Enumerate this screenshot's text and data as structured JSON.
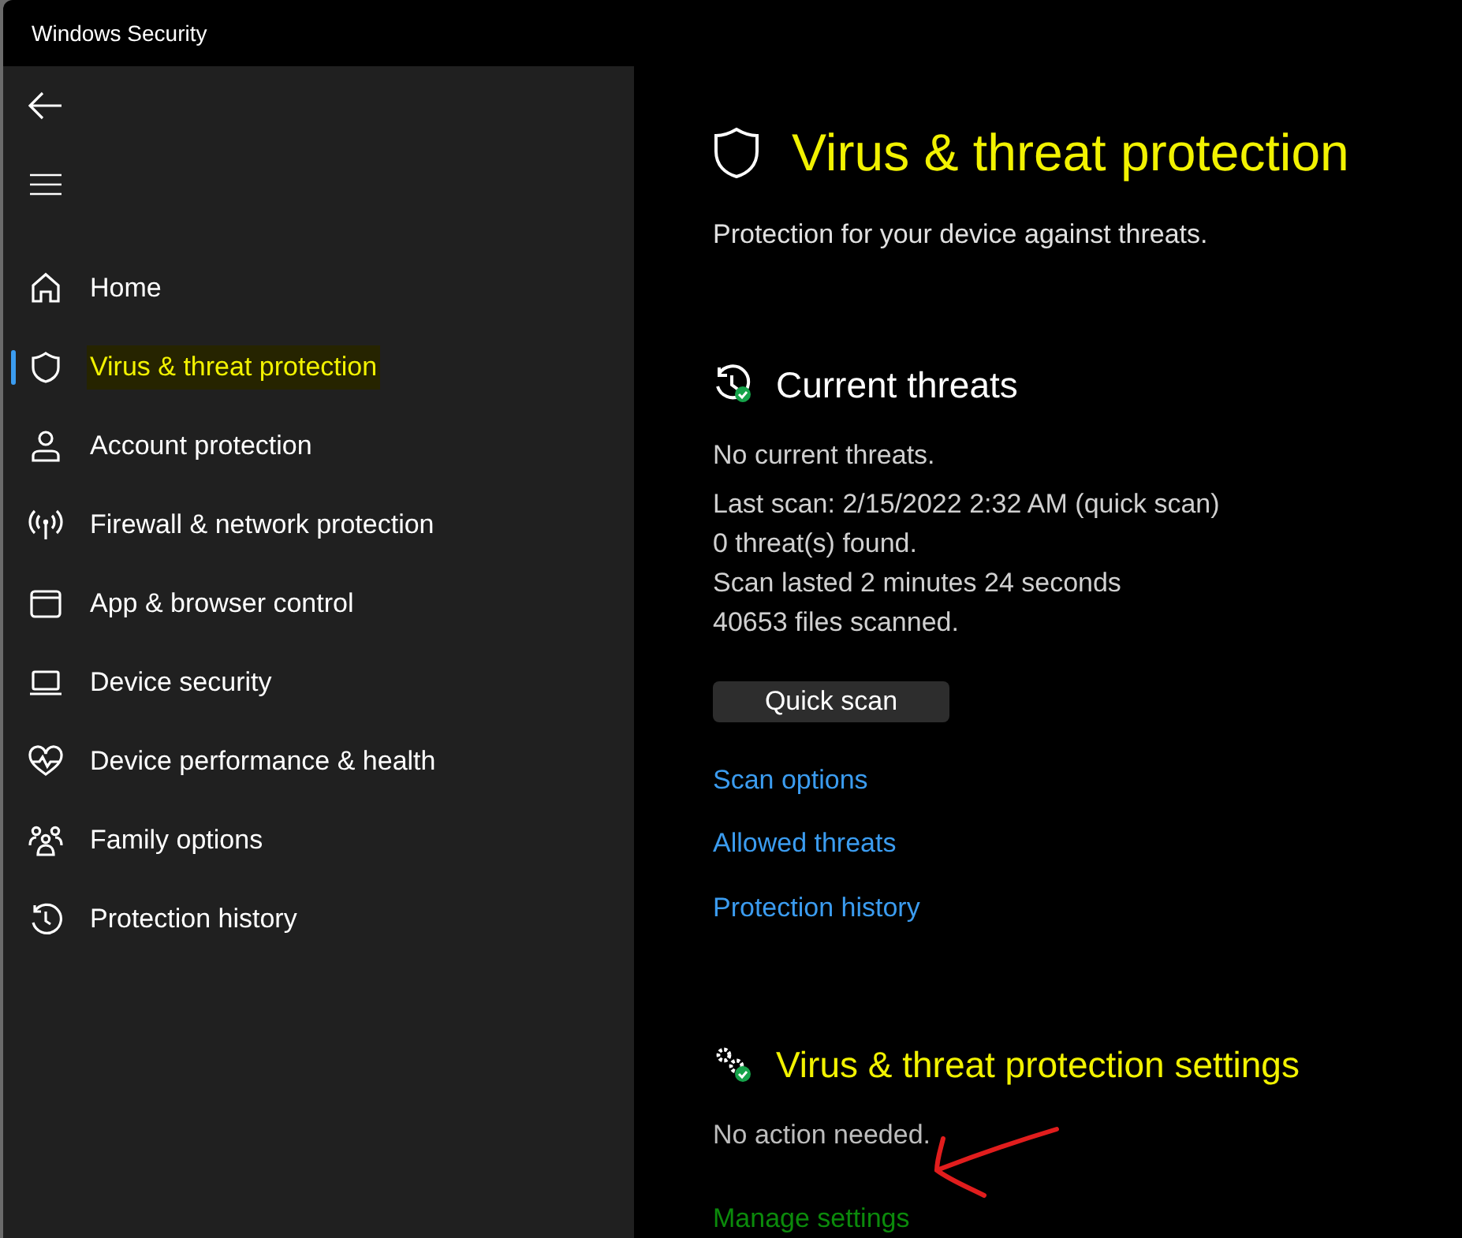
{
  "window": {
    "title": "Windows Security"
  },
  "sidebar": {
    "items": [
      {
        "label": "Home",
        "selected": false
      },
      {
        "label": "Virus & threat protection",
        "selected": true
      },
      {
        "label": "Account protection",
        "selected": false
      },
      {
        "label": "Firewall & network protection",
        "selected": false
      },
      {
        "label": "App & browser control",
        "selected": false
      },
      {
        "label": "Device security",
        "selected": false
      },
      {
        "label": "Device performance & health",
        "selected": false
      },
      {
        "label": "Family options",
        "selected": false
      },
      {
        "label": "Protection history",
        "selected": false
      }
    ]
  },
  "page": {
    "title": "Virus & threat protection",
    "subtitle": "Protection for your device against threats."
  },
  "current_threats": {
    "heading": "Current threats",
    "status": "No current threats.",
    "details": [
      "Last scan: 2/15/2022 2:32 AM (quick scan)",
      "0 threat(s) found.",
      "Scan lasted 2 minutes 24 seconds",
      "40653 files scanned."
    ],
    "button": "Quick scan",
    "links": [
      "Scan options",
      "Allowed threats",
      "Protection history"
    ]
  },
  "settings": {
    "heading": "Virus & threat protection settings",
    "status": "No action needed.",
    "link": "Manage settings"
  }
}
